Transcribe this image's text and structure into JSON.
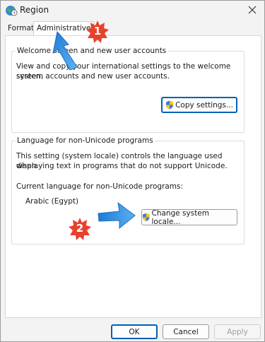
{
  "window": {
    "title": "Region",
    "close_glyph": "✕"
  },
  "tabs": [
    {
      "label": "Formats"
    },
    {
      "label": "Administrative"
    }
  ],
  "welcome_group": {
    "legend": "Welcome screen and new user accounts",
    "description_line1": "View and copy your international settings to the welcome screen,",
    "description_line2": "system accounts and new user accounts.",
    "copy_button": "Copy settings..."
  },
  "locale_group": {
    "legend": "Language for non-Unicode programs",
    "description_line1": "This setting (system locale) controls the language used when",
    "description_line2": "displaying text in programs that do not support Unicode.",
    "current_label": "Current language for non-Unicode programs:",
    "current_value": "Arabic (Egypt)",
    "change_button": "Change system locale..."
  },
  "footer": {
    "ok": "OK",
    "cancel": "Cancel",
    "apply": "Apply"
  },
  "annotations": {
    "badge_1": "1",
    "badge_2": "2"
  },
  "colors": {
    "accent": "#005fb8",
    "badge": "#e8412c",
    "arrow": "#2b8fe0"
  }
}
